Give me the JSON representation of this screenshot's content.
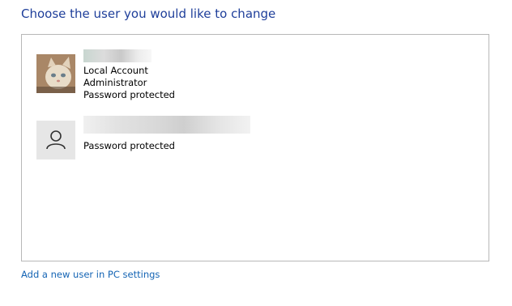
{
  "heading": "Choose the user you would like to change",
  "users": [
    {
      "avatar": "cat-photo-avatar",
      "name": "",
      "account_type": "Local Account",
      "role": "Administrator",
      "password_status": "Password protected"
    },
    {
      "avatar": "person-icon",
      "name": "",
      "password_status": "Password protected"
    }
  ],
  "add_user_link": "Add a new user in PC settings",
  "colors": {
    "heading": "#1e3e9a",
    "link": "#1464b4",
    "border": "#b8b8b8"
  }
}
